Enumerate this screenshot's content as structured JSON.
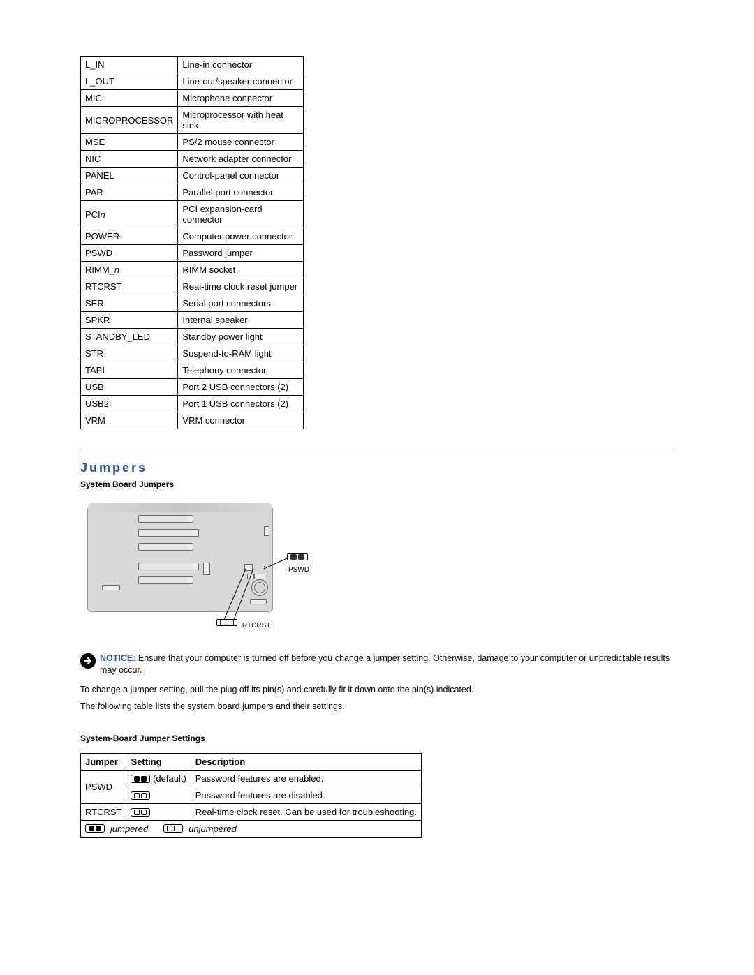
{
  "connector_table": {
    "rows": [
      {
        "label": "L_IN",
        "desc": "Line-in connector"
      },
      {
        "label": "L_OUT",
        "desc": "Line-out/speaker connector"
      },
      {
        "label": "MIC",
        "desc": "Microphone connector"
      },
      {
        "label": "MICROPROCESSOR",
        "desc": "Microprocessor with heat sink"
      },
      {
        "label": "MSE",
        "desc": "PS/2 mouse connector"
      },
      {
        "label": "NIC",
        "desc": "Network adapter connector"
      },
      {
        "label": "PANEL",
        "desc": "Control-panel connector"
      },
      {
        "label": "PAR",
        "desc": "Parallel port connector"
      },
      {
        "label": "PCIn",
        "label_italic_tail": "n",
        "label_base": "PCI",
        "desc": "PCI expansion-card connector"
      },
      {
        "label": "POWER",
        "desc": "Computer power connector"
      },
      {
        "label": "PSWD",
        "desc": "Password jumper"
      },
      {
        "label": "RIMM_n",
        "label_base": "RIMM_",
        "label_italic_tail": "n",
        "desc": "RIMM socket"
      },
      {
        "label": "RTCRST",
        "desc": "Real-time clock reset jumper"
      },
      {
        "label": "SER",
        "desc": "Serial port connectors"
      },
      {
        "label": "SPKR",
        "desc": "Internal speaker"
      },
      {
        "label": "STANDBY_LED",
        "desc": "Standby power light"
      },
      {
        "label": "STR",
        "desc": "Suspend-to-RAM light"
      },
      {
        "label": "TAPI",
        "desc": "Telephony connector"
      },
      {
        "label": "USB",
        "desc": "Port 2 USB connectors (2)"
      },
      {
        "label": "USB2",
        "desc": "Port 1 USB connectors (2)"
      },
      {
        "label": "VRM",
        "desc": "VRM connector"
      }
    ]
  },
  "jumpers": {
    "heading": "Jumpers",
    "figure_title": "System Board Jumpers",
    "callouts": {
      "pswd": "PSWD",
      "rtcrst": "RTCRST"
    },
    "notice_label": "NOTICE:",
    "notice_text": " Ensure that your computer is turned off before you change a jumper setting. Otherwise, damage to your computer or unpredictable results may occur.",
    "body1": "To change a jumper setting, pull the plug off its pin(s) and carefully fit it down onto the pin(s) indicated.",
    "body2": "The following table lists the system board jumpers and their settings.",
    "settings_title": "System-Board Jumper Settings",
    "settings_headers": {
      "jumper": "Jumper",
      "setting": "Setting",
      "description": "Description"
    },
    "settings_rows": [
      {
        "jumper": "PSWD",
        "setting_variant": "jumpered_default",
        "setting_suffix": "(default)",
        "desc": "Password features are enabled."
      },
      {
        "jumper": "",
        "setting_variant": "unjumpered",
        "setting_suffix": "",
        "desc": "Password features are disabled."
      },
      {
        "jumper": "RTCRST",
        "setting_variant": "unjumpered",
        "setting_suffix": "",
        "desc": "Real-time clock reset. Can be used for troubleshooting."
      }
    ],
    "legend": {
      "jumpered": "jumpered",
      "unjumpered": "unjumpered"
    }
  }
}
